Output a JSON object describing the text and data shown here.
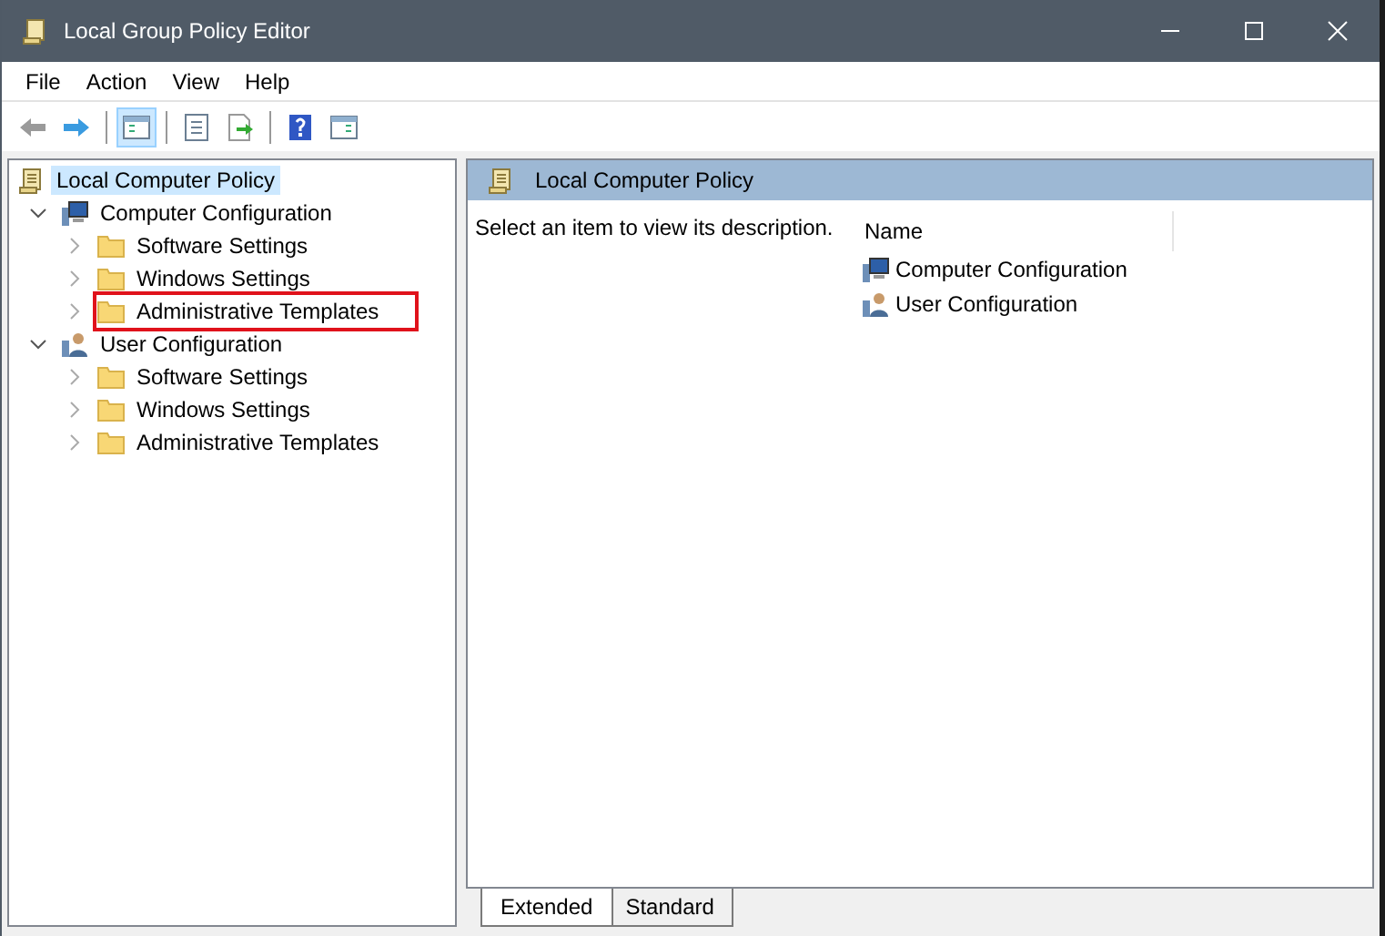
{
  "window": {
    "title": "Local Group Policy Editor"
  },
  "menu": [
    "File",
    "Action",
    "View",
    "Help"
  ],
  "toolbar_buttons": [
    {
      "pressed": false
    },
    {
      "pressed": false
    },
    {
      "pressed": true
    },
    {
      "pressed": false
    },
    {
      "pressed": false
    },
    {
      "pressed": false
    },
    {
      "pressed": false
    }
  ],
  "tree": [
    {
      "label": "Local Computer Policy",
      "kind": "policy",
      "selected": true,
      "children": [
        {
          "label": "Computer Configuration",
          "kind": "computer",
          "selected": false,
          "expanded": true,
          "children": [
            {
              "label": "Software Settings",
              "kind": "folder",
              "selected": false,
              "expanded": false
            },
            {
              "label": "Windows Settings",
              "kind": "folder",
              "selected": false,
              "expanded": false
            },
            {
              "label": "Administrative Templates",
              "kind": "folder",
              "selected": false,
              "expanded": false,
              "highlighted": true
            }
          ]
        },
        {
          "label": "User Configuration",
          "kind": "user",
          "selected": false,
          "expanded": true,
          "children": [
            {
              "label": "Software Settings",
              "kind": "folder",
              "selected": false,
              "expanded": false
            },
            {
              "label": "Windows Settings",
              "kind": "folder",
              "selected": false,
              "expanded": false
            },
            {
              "label": "Administrative Templates",
              "kind": "folder",
              "selected": false,
              "expanded": false
            }
          ]
        }
      ]
    }
  ],
  "details": {
    "header": "Local Computer Policy",
    "description": "Select an item to view its description.",
    "column": "Name",
    "items": [
      {
        "label": "Computer Configuration",
        "kind": "computer"
      },
      {
        "label": "User Configuration",
        "kind": "user"
      }
    ]
  },
  "tabs": [
    {
      "label": "Extended",
      "selected": true
    },
    {
      "label": "Standard",
      "selected": false
    }
  ]
}
